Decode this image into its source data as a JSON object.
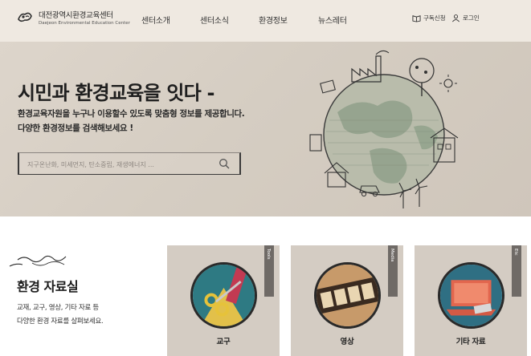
{
  "header": {
    "logo_kr": "대전광역시환경교육센터",
    "logo_en": "Daejeon Environmental Education Center",
    "nav": [
      "센터소개",
      "센터소식",
      "환경정보",
      "뉴스레터"
    ],
    "subscribe_label": "구독신청",
    "login_label": "로그인"
  },
  "hero": {
    "title": "시민과 환경교육을 잇다 -",
    "desc_line1": "환경교육자원을 누구나 이용할수 있도록 맞춤형 정보를 제공합니다.",
    "desc_line2": "다양한 환경정보를 검색해보세요 !",
    "search_placeholder": "지구온난화, 미세먼지, 탄소중립, 재생에너지 ..."
  },
  "resources": {
    "title": "환경 자료실",
    "desc_line1": "교재, 교구, 영상, 기타 자료 등",
    "desc_line2": "다양한 환경 자료를 살펴보세요.",
    "cards": [
      {
        "tag": "Tools",
        "label": "교구",
        "icon": "scissors-tools-image"
      },
      {
        "tag": "Media",
        "label": "영상",
        "icon": "film-reel-image"
      },
      {
        "tag": "Etc",
        "label": "기타 자료",
        "icon": "laptop-image"
      }
    ]
  }
}
